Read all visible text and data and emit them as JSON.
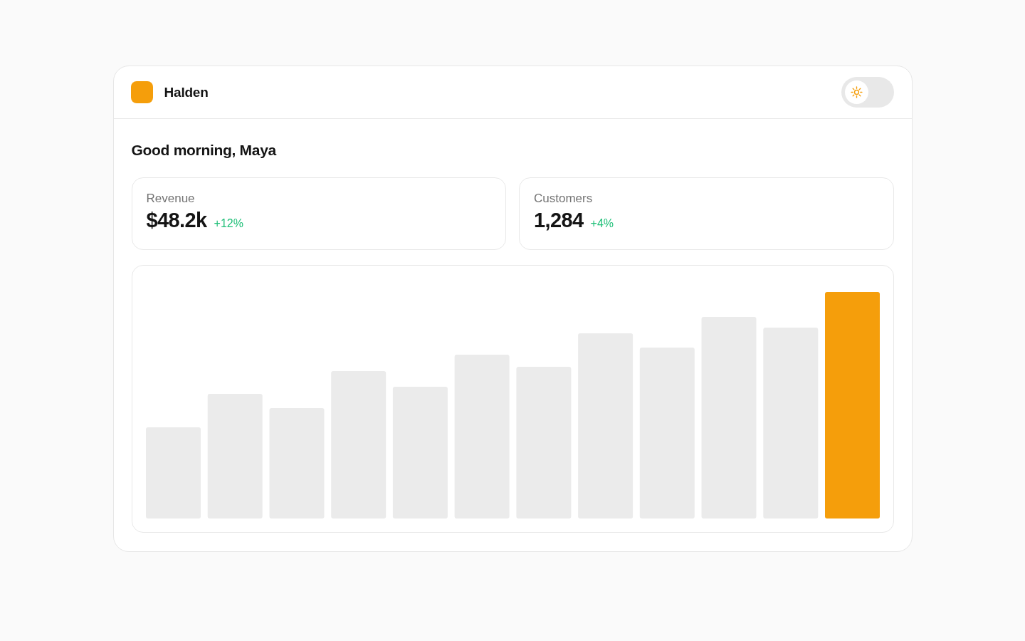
{
  "header": {
    "brand": "Halden",
    "theme_toggle": {
      "on": false
    }
  },
  "greeting": "Good morning, Maya",
  "stats": [
    {
      "label": "Revenue",
      "value": "$48.2k",
      "change": "+12%"
    },
    {
      "label": "Customers",
      "value": "1,284",
      "change": "+4%"
    }
  ]
}
